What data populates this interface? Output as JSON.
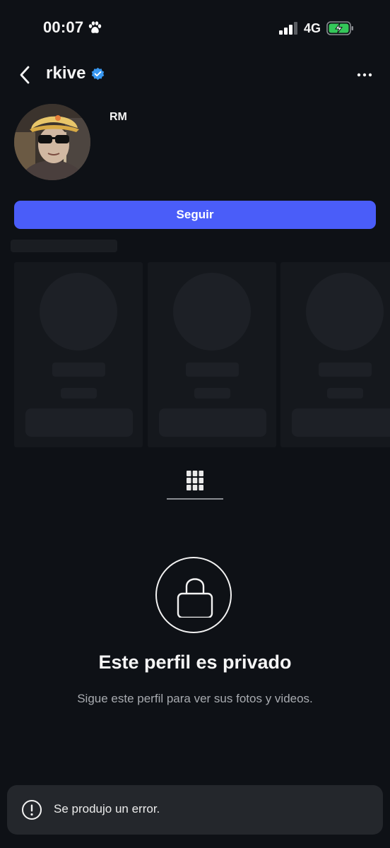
{
  "status_bar": {
    "time": "00:07",
    "network": "4G",
    "icons": [
      "paw-icon",
      "signal-icon",
      "battery-charging-icon"
    ]
  },
  "header": {
    "username": "rkive",
    "icons": [
      "back-chevron-icon",
      "verified-badge-icon",
      "more-horizontal-icon"
    ]
  },
  "profile": {
    "display_name": "RM",
    "follow_label": "Seguir"
  },
  "tabs": {
    "icons": [
      "grid-icon"
    ]
  },
  "private_notice": {
    "title": "Este perfil es privado",
    "subtitle": "Sigue este perfil para ver sus fotos y videos.",
    "icons": [
      "lock-icon"
    ]
  },
  "toast": {
    "message": "Se produjo un error.",
    "icons": [
      "alert-circle-icon"
    ]
  },
  "colors": {
    "background": "#0e1116",
    "accent": "#4a5df9",
    "verified": "#3897f0",
    "battery_charge": "#34c759",
    "toast_bg": "#24272c"
  }
}
